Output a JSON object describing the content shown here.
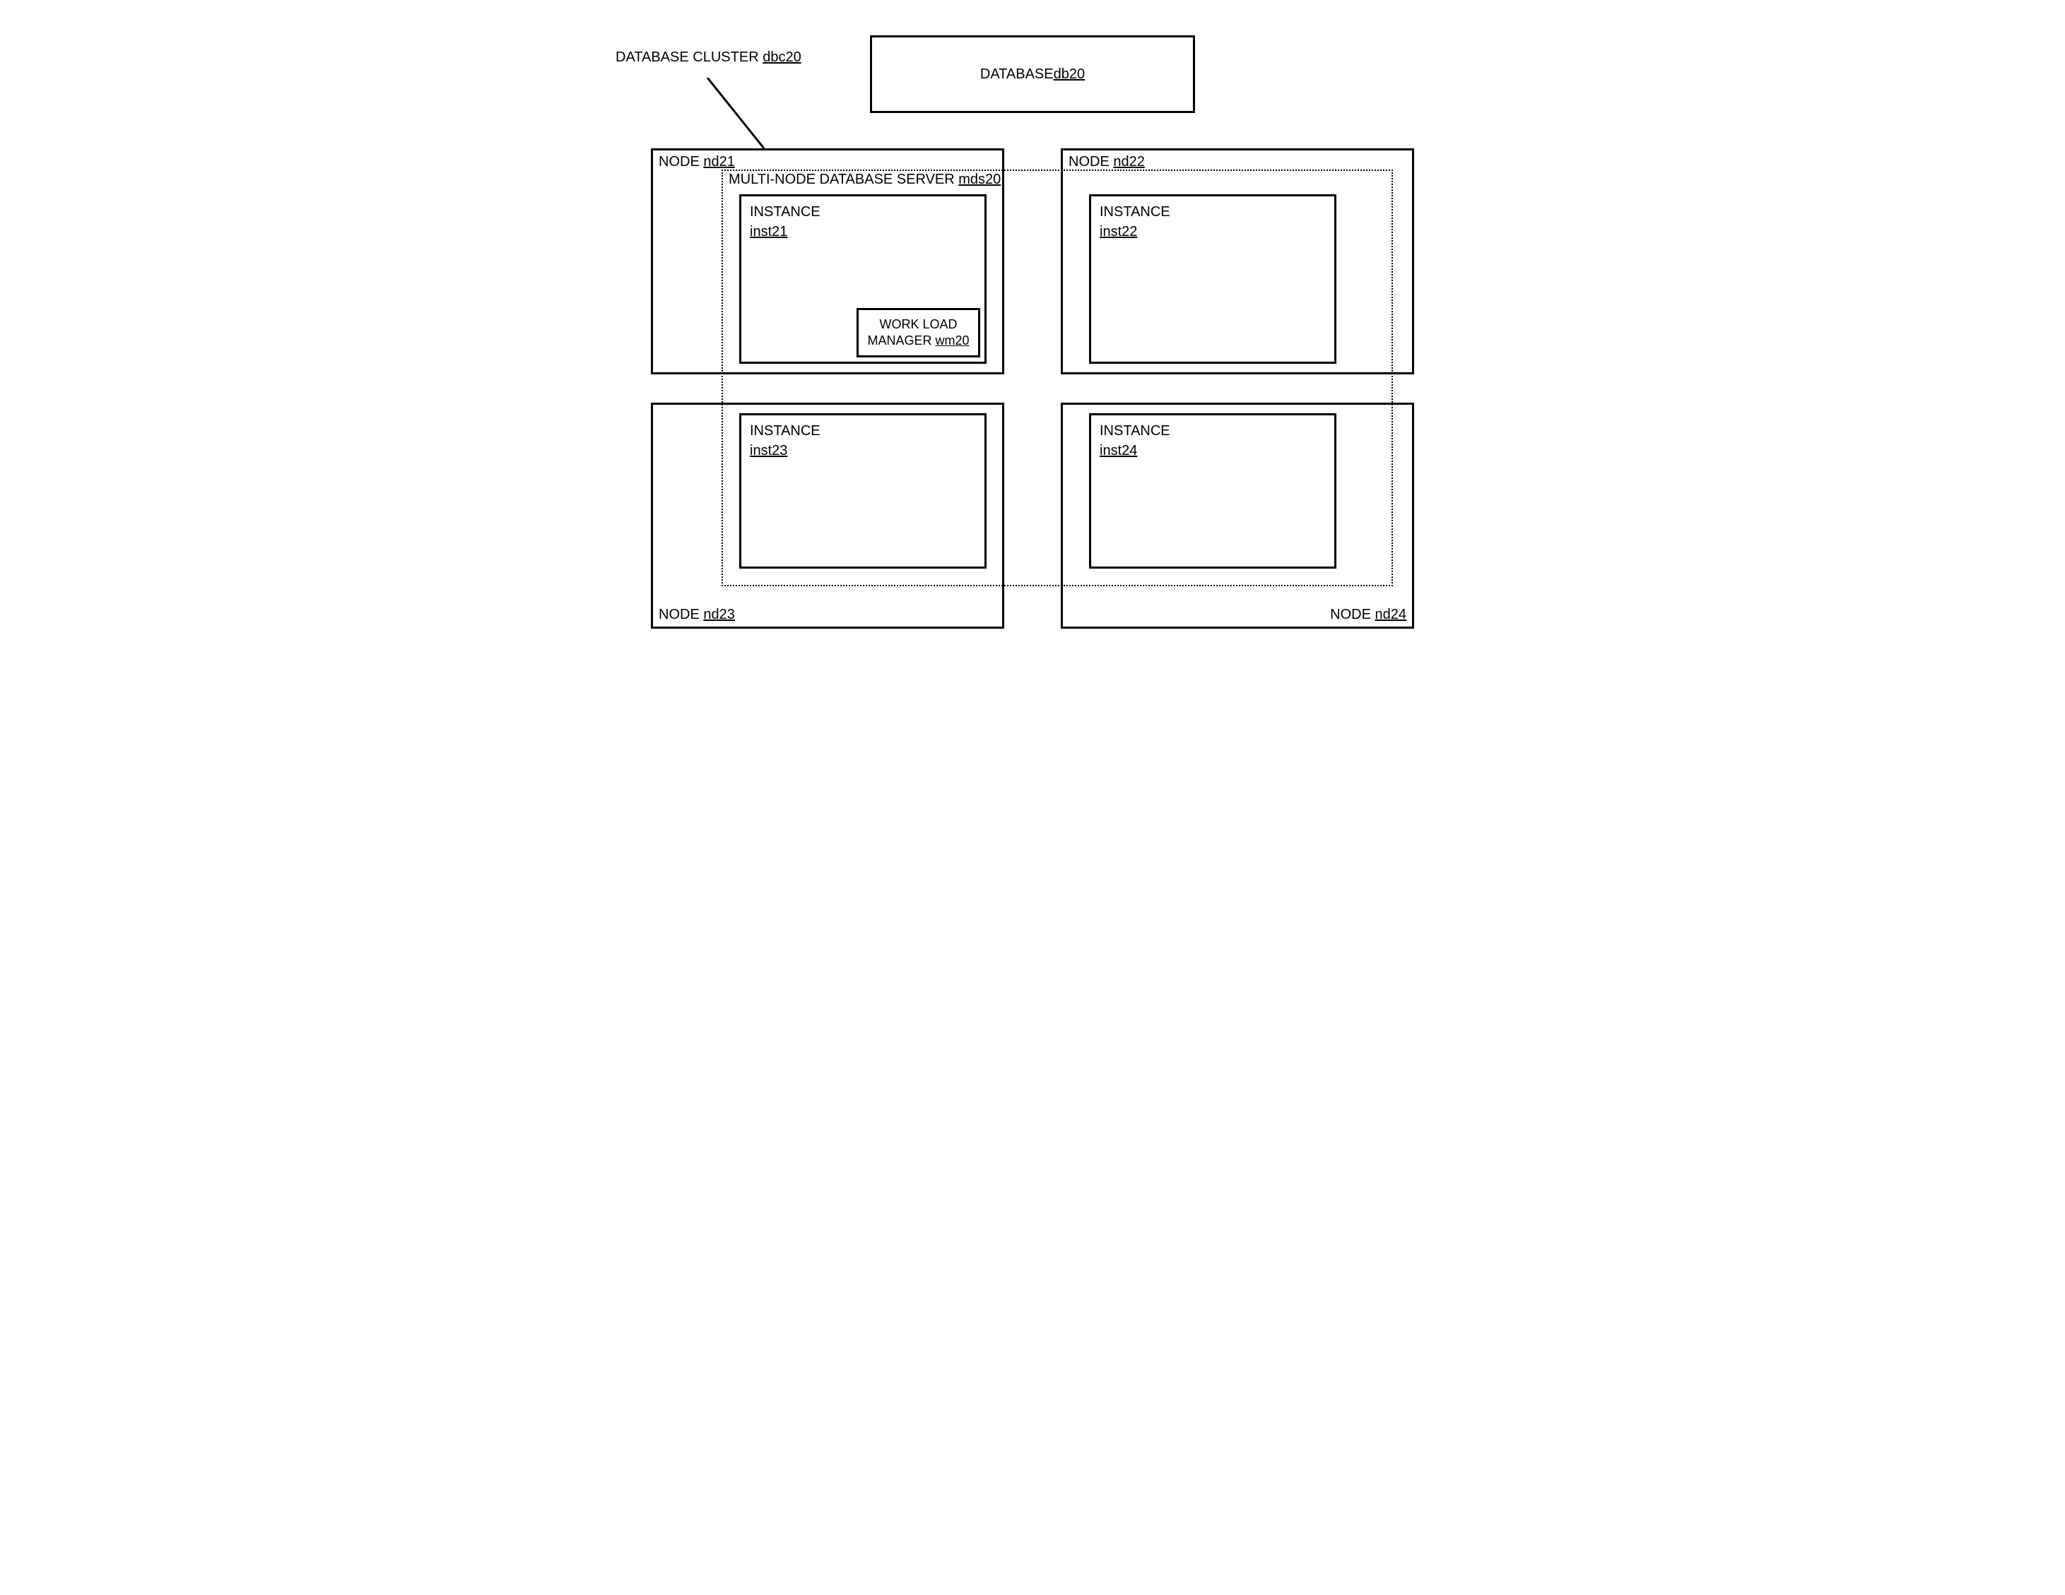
{
  "cluster": {
    "label_prefix": "DATABASE CLUSTER ",
    "id": "dbc20"
  },
  "database": {
    "label_prefix": "DATABASE  ",
    "id": "db20"
  },
  "mds": {
    "label_prefix": "MULTI-NODE DATABASE  SERVER ",
    "id": "mds20"
  },
  "nodes": {
    "nd21": {
      "label_prefix": "NODE ",
      "id": "nd21"
    },
    "nd22": {
      "label_prefix": "NODE ",
      "id": "nd22"
    },
    "nd23": {
      "label_prefix": "NODE ",
      "id": "nd23"
    },
    "nd24": {
      "label_prefix": "NODE ",
      "id": "nd24"
    }
  },
  "instances": {
    "inst21": {
      "label": "INSTANCE",
      "id": "inst21"
    },
    "inst22": {
      "label": "INSTANCE",
      "id": "inst22"
    },
    "inst23": {
      "label": "INSTANCE",
      "id": "inst23"
    },
    "inst24": {
      "label": "INSTANCE",
      "id": "inst24"
    }
  },
  "workload": {
    "line1": "WORK LOAD",
    "line2_prefix": "MANAGER ",
    "id": "wm20"
  }
}
